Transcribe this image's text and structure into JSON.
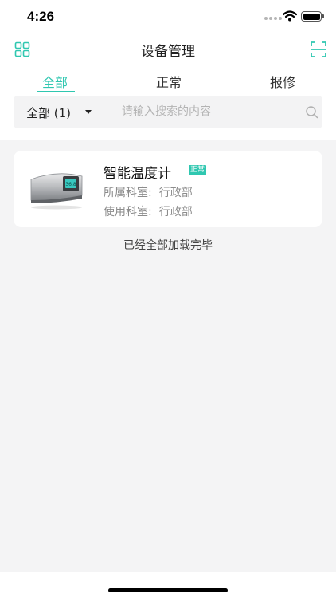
{
  "status_bar": {
    "time": "4:26"
  },
  "nav": {
    "title": "设备管理",
    "left_icon": "grid-icon",
    "right_icon": "scan-icon"
  },
  "tabs": [
    {
      "label": "全部",
      "active": true
    },
    {
      "label": "正常",
      "active": false
    },
    {
      "label": "报修",
      "active": false
    }
  ],
  "search": {
    "filter_label": "全部 (1)",
    "placeholder": "请输入搜索的内容"
  },
  "devices": [
    {
      "name": "智能温度计",
      "status": "正常",
      "dept_label": "所属科室:",
      "dept_value": "行政部",
      "use_label": "使用科室:",
      "use_value": "行政部"
    }
  ],
  "footer_text": "已经全部加载完毕",
  "colors": {
    "accent": "#2fc7b0",
    "background": "#f4f4f5"
  }
}
